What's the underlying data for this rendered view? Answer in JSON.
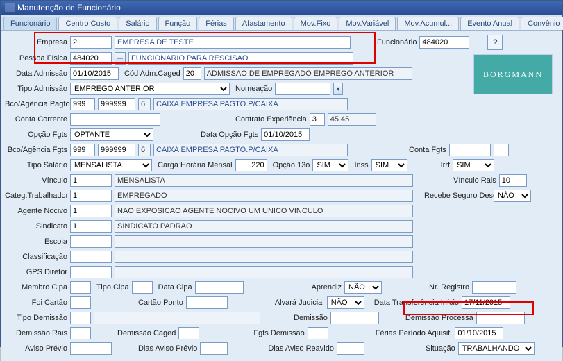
{
  "window": {
    "title": "Manutenção de Funcionário"
  },
  "tabs": {
    "funcionario": "Funcionário",
    "centro_custo": "Centro Custo",
    "salario": "Salário",
    "funcao": "Função",
    "ferias": "Férias",
    "afastamento": "Afastamento",
    "mov_fixo": "Mov.Fixo",
    "mov_variavel": "Mov.Variável",
    "mov_acumul": "Mov.Acumul...",
    "evento_anual": "Evento Anual",
    "convenio": "Convênio"
  },
  "labels": {
    "empresa": "Empresa",
    "funcionario": "Funcionário",
    "pessoa_fisica": "Pessoa Física",
    "data_admissao": "Data Admissão",
    "cod_adm_caged": "Cód Adm.Caged",
    "tipo_admissao": "Tipo Admissão",
    "nomeacao": "Nomeação",
    "bco_ag_pagto": "Bco/Agência Pagto",
    "conta_corrente": "Conta Corrente",
    "contrato_exp": "Contrato Experiência",
    "opcao_fgts": "Opção Fgts",
    "data_opcao_fgts": "Data Opção Fgts",
    "bco_ag_fgts": "Bco/Agência Fgts",
    "conta_fgts": "Conta Fgts",
    "tipo_salario": "Tipo Salário",
    "carga_horaria": "Carga Horária Mensal",
    "opcao_13o": "Opção 13o",
    "inss": "Inss",
    "irrf": "Irrf",
    "vinculo": "Vínculo",
    "vinculo_rais": "Vínculo Rais",
    "categ_trab": "Categ.Trabalhador",
    "recebe_seguro": "Recebe Seguro Desemprego",
    "agente_nocivo": "Agente Nocivo",
    "sindicato": "Sindicato",
    "escola": "Escola",
    "classificacao": "Classificação",
    "gps_diretor": "GPS Diretor",
    "membro_cipa": "Membro Cipa",
    "tipo_cipa": "Tipo Cipa",
    "data_cipa": "Data Cipa",
    "aprendiz": "Aprendiz",
    "nr_registro": "Nr. Registro",
    "foi_cartao": "Foi Cartão",
    "cartao_ponto": "Cartão Ponto",
    "alvara_judicial": "Alvará Judicial",
    "data_transf_inicio": "Data Transferência Início",
    "tipo_demissao": "Tipo Demissão",
    "demissao": "Demissão",
    "demissao_processa": "Demissão Processa",
    "demissao_rais": "Demissão Rais",
    "demissao_caged": "Demissão Caged",
    "fgts_demissao": "Fgts Demissão",
    "ferias_periodo": "Férias Período Aquisit.",
    "aviso_previo": "Aviso Prévio",
    "dias_aviso_previo": "Dias Aviso Prévio",
    "dias_aviso_reavido": "Dias Aviso Reavido",
    "situacao": "Situação"
  },
  "values": {
    "empresa_cod": "2",
    "empresa_nome": "EMPRESA DE TESTE",
    "funcionario_cod": "484020",
    "pessoa_fisica_cod": "484020",
    "pessoa_fisica_nome": "FUNCIONARIO PARA RESCISAO",
    "data_admissao": "01/10/2015",
    "cod_adm_caged": "20",
    "cod_adm_caged_desc": "ADMISSAO DE EMPREGADO EMPREGO ANTERIOR",
    "tipo_admissao": "EMPREGO ANTERIOR",
    "nomeacao": "",
    "bco_pagto": "999",
    "ag_pagto": "999999",
    "ag_pagto_dv": "6",
    "bco_pagto_nome": "CAIXA EMPRESA PAGTO.P/CAIXA",
    "conta_corrente": "",
    "contrato_exp": "3",
    "contrato_exp_aux": "45 45",
    "opcao_fgts": "OPTANTE",
    "data_opcao_fgts": "01/10/2015",
    "bco_fgts": "999",
    "ag_fgts": "999999",
    "ag_fgts_dv": "6",
    "bco_fgts_nome": "CAIXA EMPRESA PAGTO.P/CAIXA",
    "conta_fgts": "",
    "tipo_salario": "MENSALISTA",
    "carga_horaria": "220",
    "opcao_13o": "SIM",
    "inss": "SIM",
    "irrf": "SIM",
    "vinculo_cod": "1",
    "vinculo_desc": "MENSALISTA",
    "vinculo_rais": "10",
    "categ_trab_cod": "1",
    "categ_trab_desc": "EMPREGADO",
    "recebe_seguro": "NÃO",
    "agente_nocivo_cod": "1",
    "agente_nocivo_desc": "NAO EXPOSICAO AGENTE NOCIVO UM UNICO VINCULO",
    "sindicato_cod": "1",
    "sindicato_desc": "SINDICATO PADRAO",
    "escola_cod": "",
    "escola_desc": "",
    "classificacao_cod": "",
    "classificacao_desc": "",
    "gps_diretor_cod": "",
    "gps_diretor_desc": "",
    "membro_cipa": "",
    "tipo_cipa": "",
    "data_cipa": "",
    "aprendiz": "NÃO",
    "nr_registro": "",
    "foi_cartao": "",
    "cartao_ponto": "",
    "alvara_judicial": "NÃO",
    "data_transf_inicio": "17/11/2015",
    "tipo_demissao_cod": "",
    "tipo_demissao_desc": "",
    "demissao": "",
    "demissao_processa": "",
    "demissao_rais_cod": "",
    "demissao_rais_desc": "",
    "demissao_caged_cod": "",
    "demissao_caged_desc": "",
    "fgts_demissao_cod": "",
    "fgts_demissao_desc": "",
    "ferias_periodo": "01/10/2015",
    "aviso_previo": "",
    "dias_aviso_previo": "",
    "dias_aviso_reavido": "",
    "situacao": "TRABALHANDO"
  },
  "logo_text": "BORGMANN",
  "help": "?"
}
